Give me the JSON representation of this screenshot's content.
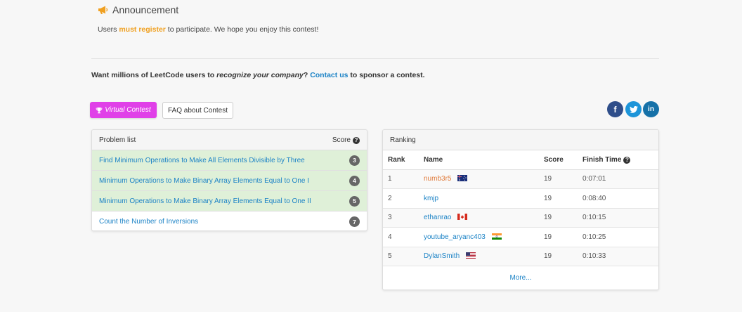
{
  "announcement": {
    "title": "Announcement",
    "text_before": "Users ",
    "highlight": "must register",
    "text_after": " to participate. We hope you enjoy this contest!"
  },
  "sponsor": {
    "text_before": "Want millions of LeetCode users to ",
    "emphasis": "recognize your company",
    "text_mid": "? ",
    "link": "Contact us",
    "text_after": " to sponsor a contest."
  },
  "buttons": {
    "virtual": "Virtual Contest",
    "faq": "FAQ about Contest"
  },
  "social": {
    "facebook": "f",
    "linkedin": "in"
  },
  "problems": {
    "header": "Problem list",
    "score_label": "Score",
    "items": [
      {
        "title": "Find Minimum Operations to Make All Elements Divisible by Three",
        "score": "3"
      },
      {
        "title": "Minimum Operations to Make Binary Array Elements Equal to One I",
        "score": "4"
      },
      {
        "title": "Minimum Operations to Make Binary Array Elements Equal to One II",
        "score": "5"
      },
      {
        "title": "Count the Number of Inversions",
        "score": "7"
      }
    ]
  },
  "ranking": {
    "header": "Ranking",
    "columns": {
      "rank": "Rank",
      "name": "Name",
      "score": "Score",
      "finish": "Finish Time"
    },
    "rows": [
      {
        "rank": "1",
        "name": "numb3r5",
        "score": "19",
        "time": "0:07:01"
      },
      {
        "rank": "2",
        "name": "kmjp",
        "score": "19",
        "time": "0:08:40"
      },
      {
        "rank": "3",
        "name": "ethanrao",
        "score": "19",
        "time": "0:10:15"
      },
      {
        "rank": "4",
        "name": "youtube_aryanc403",
        "score": "19",
        "time": "0:10:25"
      },
      {
        "rank": "5",
        "name": "DylanSmith",
        "score": "19",
        "time": "0:10:33"
      }
    ],
    "more": "More..."
  },
  "colors": {
    "accent_purple": "#e040e8",
    "link_blue": "#1c83c6",
    "solved_green": "#dff0d8",
    "highlight_orange": "#f0a020"
  }
}
